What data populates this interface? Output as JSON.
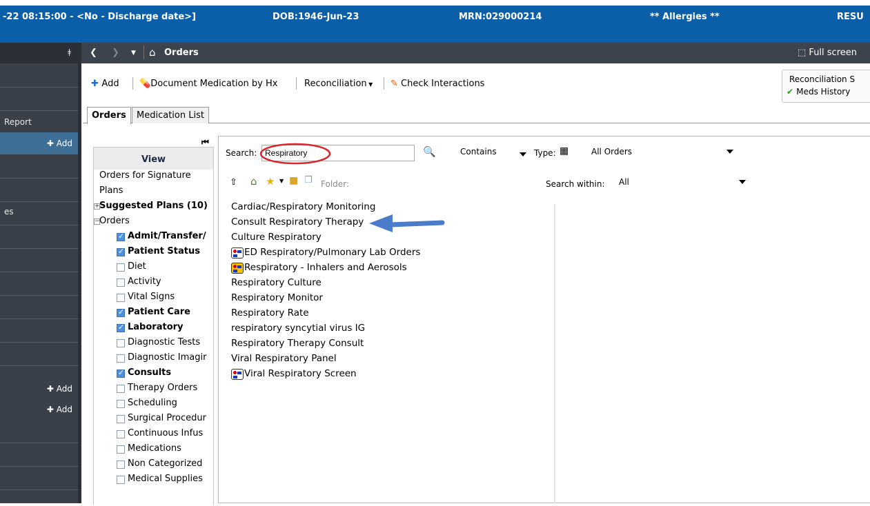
{
  "banner": {
    "admit_discharge": "-22 08:15:00 - <No - Discharge date>]",
    "dob": "DOB:1946-Jun-23",
    "mrn": "MRN:029000214",
    "allergies": "** Allergies **",
    "resus": "RESU"
  },
  "sidebar": {
    "report_label": "Report",
    "add_label": "Add",
    "es_label": "es",
    "add_label_2": "Add",
    "add_label_3": "Add"
  },
  "navbar": {
    "title": "Orders",
    "full_screen": "Full screen"
  },
  "toolbar": {
    "add": "Add",
    "document_med": "Document Medication by Hx",
    "reconciliation": "Reconciliation",
    "check_interactions": "Check Interactions",
    "recon_status_title": "Reconciliation S",
    "meds_history": "Meds History"
  },
  "tabs": [
    {
      "label": "Orders"
    },
    {
      "label": "Medication List"
    }
  ],
  "view_panel": {
    "header": "View",
    "items": [
      {
        "label": "Orders for Signature"
      },
      {
        "label": "Plans"
      },
      {
        "label": "Suggested Plans (10)"
      },
      {
        "label": "Orders"
      },
      {
        "label": "Admit/Transfer/"
      },
      {
        "label": "Patient Status"
      },
      {
        "label": "Diet"
      },
      {
        "label": "Activity"
      },
      {
        "label": "Vital Signs"
      },
      {
        "label": "Patient Care"
      },
      {
        "label": "Laboratory"
      },
      {
        "label": "Diagnostic Tests"
      },
      {
        "label": "Diagnostic Imagir"
      },
      {
        "label": "Consults"
      },
      {
        "label": "Therapy Orders"
      },
      {
        "label": "Scheduling"
      },
      {
        "label": "Surgical Procedur"
      },
      {
        "label": "Continuous Infus"
      },
      {
        "label": "Medications"
      },
      {
        "label": "Non Categorized"
      },
      {
        "label": "Medical Supplies"
      }
    ]
  },
  "search": {
    "label": "Search:",
    "value": "Respiratory",
    "match_mode": "Contains",
    "type_label": "Type:",
    "type_value": "All Orders",
    "folder_label": "Folder:",
    "search_within_label": "Search within:",
    "search_within_value": "All"
  },
  "results": [
    {
      "label": "Cardiac/Respiratory Monitoring"
    },
    {
      "label": "Consult Respiratory Therapy"
    },
    {
      "label": "Culture Respiratory"
    },
    {
      "label": "ED Respiratory/Pulmonary Lab Orders"
    },
    {
      "label": "Respiratory - Inhalers and Aerosols"
    },
    {
      "label": "Respiratory Culture"
    },
    {
      "label": "Respiratory Monitor"
    },
    {
      "label": "Respiratory Rate"
    },
    {
      "label": "respiratory syncytial virus IG"
    },
    {
      "label": "Respiratory Therapy Consult"
    },
    {
      "label": "Viral Respiratory Panel"
    },
    {
      "label": "Viral Respiratory Screen"
    }
  ],
  "colors": {
    "banner_bg": "#0b5ea8",
    "sidebar_bg": "#3a4049",
    "annotation_arrow": "#4a7cc9",
    "annotation_circle": "#d9262b"
  }
}
